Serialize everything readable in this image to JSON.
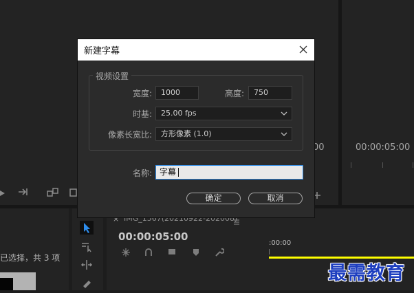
{
  "background": {
    "tc_right": "00:00:05:00",
    "tc_partial": "00",
    "tc_program": "00:00:05:00",
    "seq_tab": "IMG_1567(20210922-202008)",
    "ruler_time": ":00:00",
    "project_status": "已选择，共 3 项",
    "watermark": "最需教育",
    "accent_yellow": "#ffff00",
    "accent_blue": "#2d8ceb"
  },
  "dialog": {
    "title": "新建字幕",
    "section": "视频设置",
    "width_label": "宽度:",
    "width_value": "1000",
    "height_label": "高度:",
    "height_value": "750",
    "timebase_label": "时基:",
    "timebase_value": "25.00 fps",
    "par_label": "像素长宽比:",
    "par_value": "方形像素 (1.0)",
    "name_label": "名称:",
    "name_value": "字幕",
    "ok": "确定",
    "cancel": "取消"
  }
}
